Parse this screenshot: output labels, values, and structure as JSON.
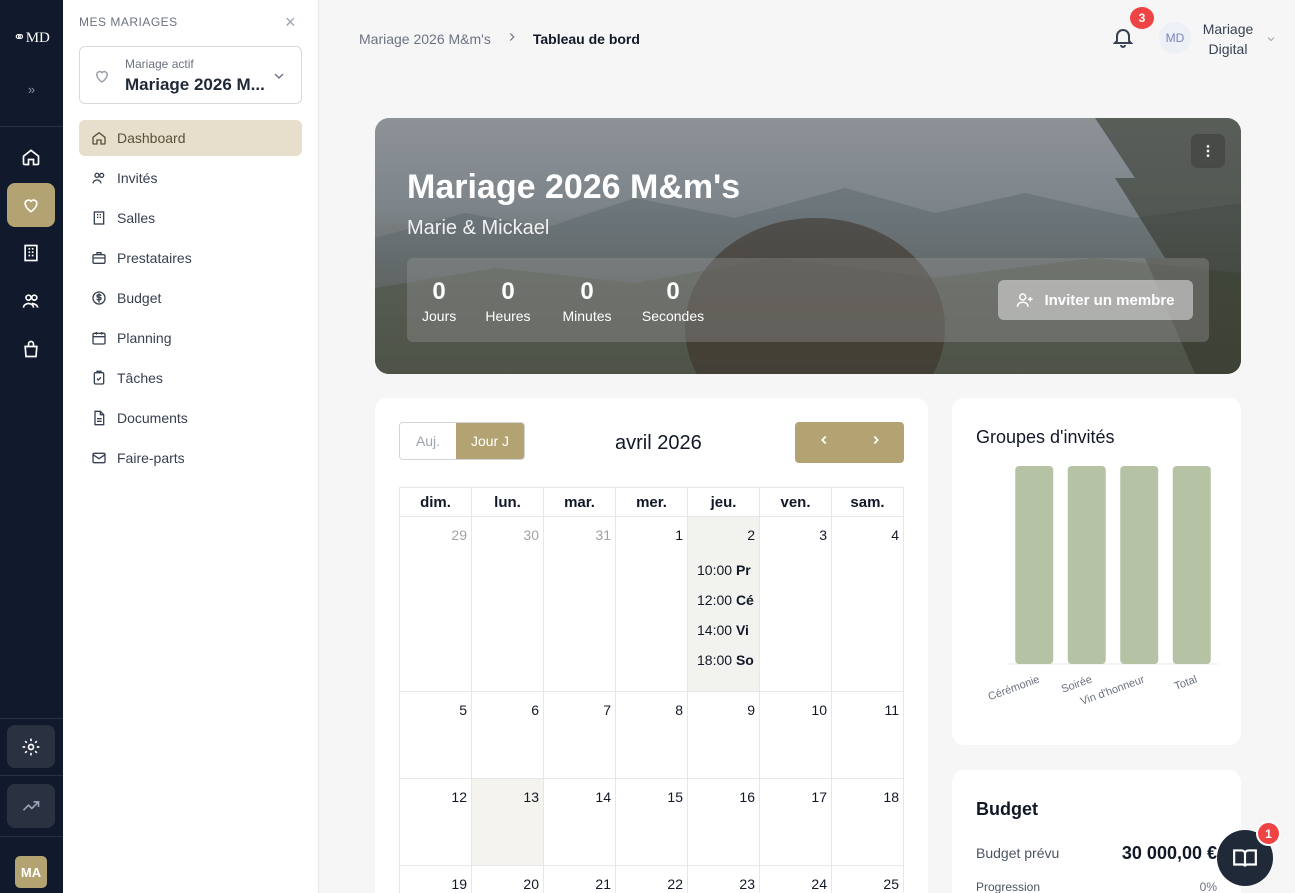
{
  "rail": {
    "logo": "MD",
    "expand": "»",
    "avatar": "MA"
  },
  "sidebar": {
    "heading": "MES MARIAGES",
    "close": "×",
    "selector": {
      "small": "Mariage actif",
      "value": "Mariage 2026 M..."
    },
    "items": [
      {
        "label": "Dashboard",
        "icon": "home-icon",
        "active": true
      },
      {
        "label": "Invités",
        "icon": "users-icon"
      },
      {
        "label": "Salles",
        "icon": "building-icon"
      },
      {
        "label": "Prestataires",
        "icon": "briefcase-icon"
      },
      {
        "label": "Budget",
        "icon": "dollar-icon"
      },
      {
        "label": "Planning",
        "icon": "calendar-icon"
      },
      {
        "label": "Tâches",
        "icon": "clipboard-icon"
      },
      {
        "label": "Documents",
        "icon": "document-icon"
      },
      {
        "label": "Faire-parts",
        "icon": "mail-icon"
      }
    ]
  },
  "header": {
    "breadcrumb": {
      "parent": "Mariage 2026 M&m's",
      "current": "Tableau de bord"
    },
    "notifications": "3",
    "user": {
      "initials": "MD",
      "name": "Mariage Digital"
    }
  },
  "hero": {
    "title": "Mariage 2026 M&m's",
    "couple": "Marie & Mickael",
    "countdown": [
      {
        "value": "0",
        "label": "Jours"
      },
      {
        "value": "0",
        "label": "Heures"
      },
      {
        "value": "0",
        "label": "Minutes"
      },
      {
        "value": "0",
        "label": "Secondes"
      }
    ],
    "invite_label": "Inviter un membre"
  },
  "calendar": {
    "today_btn": "Auj.",
    "dday_btn": "Jour J",
    "month": "avril 2026",
    "weekdays": [
      "dim.",
      "lun.",
      "mar.",
      "mer.",
      "jeu.",
      "ven.",
      "sam."
    ],
    "weeks": [
      [
        "29",
        "30",
        "31",
        "1",
        "2",
        "3",
        "4"
      ],
      [
        "5",
        "6",
        "7",
        "8",
        "9",
        "10",
        "11"
      ],
      [
        "12",
        "13",
        "14",
        "15",
        "16",
        "17",
        "18"
      ],
      [
        "19",
        "20",
        "21",
        "22",
        "23",
        "24",
        "25"
      ]
    ],
    "events": [
      {
        "time": "10:00",
        "title": "Pr"
      },
      {
        "time": "12:00",
        "title": "Cé"
      },
      {
        "time": "14:00",
        "title": "Vi"
      },
      {
        "time": "18:00",
        "title": "So"
      }
    ]
  },
  "groups": {
    "title": "Groupes d'invités",
    "bar_color": "#b6c2a4"
  },
  "chart_data": {
    "type": "bar",
    "title": "Groupes d'invités",
    "categories": [
      "Cérémonie",
      "Soirée",
      "Vin d'honneur",
      "Total"
    ],
    "values": [
      1,
      1,
      1,
      1
    ],
    "ylim": [
      0,
      1
    ],
    "grid": false
  },
  "budget": {
    "title": "Budget",
    "planned_label": "Budget prévu",
    "planned_value": "30 000,00 €",
    "progress_label": "Progression",
    "progress_value": "0%"
  },
  "fab_badge": "1"
}
